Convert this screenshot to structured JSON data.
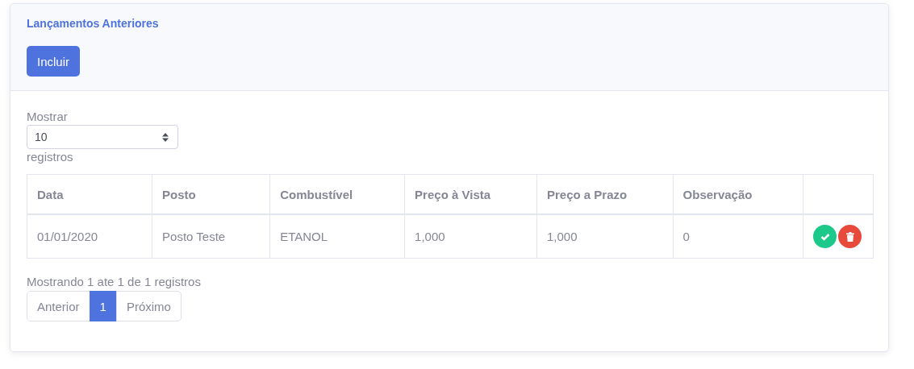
{
  "card": {
    "title": "Lançamentos Anteriores",
    "add_button": "Incluir"
  },
  "length_menu": {
    "before": "Mostrar",
    "value": "10",
    "after": "registros"
  },
  "table": {
    "columns": [
      "Data",
      "Posto",
      "Combustível",
      "Preço à Vista",
      "Preço a Prazo",
      "Observação"
    ],
    "rows": [
      {
        "cells": [
          "01/01/2020",
          "Posto Teste",
          "ETANOL",
          "1,000",
          "1,000",
          "0"
        ],
        "actions": [
          {
            "kind": "approve"
          },
          {
            "kind": "delete"
          }
        ]
      }
    ]
  },
  "info": "Mostrando 1 ate 1 de 1 registros",
  "pagination": [
    {
      "label": "Anterior",
      "selected": false
    },
    {
      "label": "1",
      "selected": true
    },
    {
      "label": "Próximo",
      "selected": false
    }
  ]
}
